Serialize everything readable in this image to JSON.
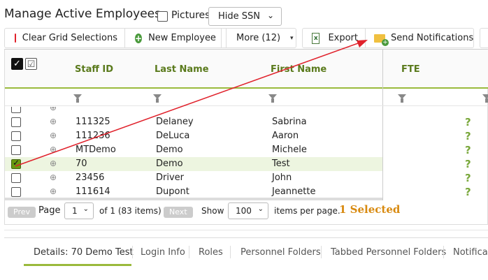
{
  "header": {
    "title": "Manage Active Employees",
    "pictures_label": "Pictures",
    "ssn_select_value": "Hide SSN"
  },
  "toolbar": {
    "clear_label": "Clear Grid Selections",
    "new_employee_label": "New Employee",
    "more_label": "More (12)",
    "export_label": "Export",
    "send_notifications_label": "Send Notifications"
  },
  "grid": {
    "columns": [
      "Staff ID",
      "Last Name",
      "First Name",
      "FTE"
    ],
    "rows": [
      {
        "staff_id": "111325",
        "last_name": "Delaney",
        "first_name": "Sabrina",
        "fte": "?",
        "checked": false
      },
      {
        "staff_id": "111236",
        "last_name": "DeLuca",
        "first_name": "Aaron",
        "fte": "?",
        "checked": false
      },
      {
        "staff_id": "MTDemo",
        "last_name": "Demo",
        "first_name": "Michele",
        "fte": "?",
        "checked": false
      },
      {
        "staff_id": "70",
        "last_name": "Demo",
        "first_name": "Test",
        "fte": "?",
        "checked": true
      },
      {
        "staff_id": "23456",
        "last_name": "Driver",
        "first_name": "John",
        "fte": "?",
        "checked": false
      },
      {
        "staff_id": "111614",
        "last_name": "Dupont",
        "first_name": "Jeannette",
        "fte": "?",
        "checked": false
      }
    ]
  },
  "pager": {
    "prev_label": "Prev",
    "page_label": "Page",
    "page_value": "1",
    "of_text": "of 1 (83 items)",
    "next_label": "Next",
    "show_label": "Show",
    "per_page_value": "100",
    "per_page_text": "items per page.",
    "selected_text": "1 Selected"
  },
  "detail_tabs": [
    "Details: 70 Demo Test",
    "Login Info",
    "Roles",
    "Personnel Folders",
    "Tabbed Personnel Folders",
    "Notificati"
  ],
  "colors": {
    "accent_green": "#9aba3c",
    "header_text": "#5a7a1c",
    "selected_orange": "#d88a10",
    "annotation_red": "#e0212b"
  }
}
